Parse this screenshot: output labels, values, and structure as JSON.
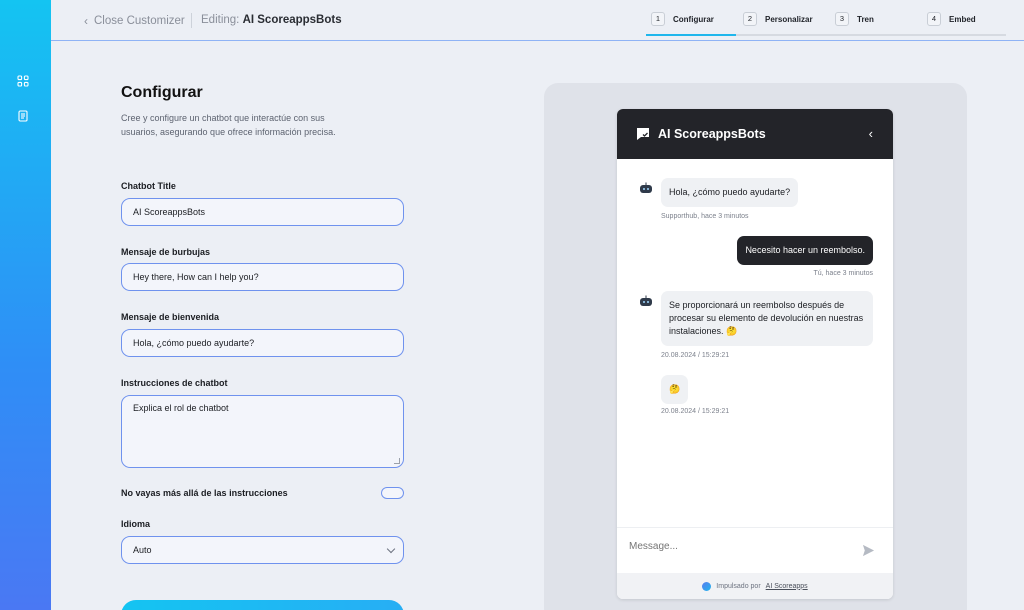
{
  "header": {
    "close_label": "Close Customizer",
    "editing_prefix": "Editing:",
    "editing_name": "AI ScoreappsBots"
  },
  "steps": [
    {
      "num": "1",
      "label": "Configurar"
    },
    {
      "num": "2",
      "label": "Personalizar"
    },
    {
      "num": "3",
      "label": "Tren"
    },
    {
      "num": "4",
      "label": "Embed"
    }
  ],
  "form": {
    "title": "Configurar",
    "description": "Cree y configure un chatbot que interactúe con sus usuarios, asegurando que ofrece información precisa.",
    "chatbot_title_label": "Chatbot Title",
    "chatbot_title_value": "AI ScoreappsBots",
    "bubble_label": "Mensaje de burbujas",
    "bubble_value": "Hey there, How can I help you?",
    "welcome_label": "Mensaje de bienvenida",
    "welcome_value": "Hola, ¿cómo puedo ayudarte?",
    "instructions_label": "Instrucciones de chatbot",
    "instructions_value": "Explica el rol de chatbot",
    "toggle_label": "No vayas más allá de las instrucciones",
    "language_label": "Idioma",
    "language_value": "Auto"
  },
  "chat": {
    "title": "AI ScoreappsBots",
    "messages": [
      {
        "text": "Hola, ¿cómo puedo ayudarte?",
        "meta": "Supporthub, hace 3 minutos"
      },
      {
        "text": "Necesito hacer un reembolso.",
        "meta": "Tú, hace 3 minutos"
      },
      {
        "text": "Se proporcionará un reembolso después de procesar su elemento de devolución en nuestras instalaciones. 🤔",
        "meta": "20.08.2024 / 15:29:21"
      },
      {
        "text": "🤔",
        "meta": "20.08.2024 / 15:29:21"
      }
    ],
    "input_placeholder": "Message...",
    "footer_prefix": "Impulsado por",
    "footer_link": "AI Scoreapps"
  },
  "colors": {
    "accent": "#1fb6ec",
    "input_border": "#6f92ee",
    "chat_dark": "#232429"
  },
  "icons": {
    "rail": [
      "grid-icon",
      "document-icon"
    ],
    "chat_logo": "chat-bubble-icon",
    "send": "send-icon"
  }
}
